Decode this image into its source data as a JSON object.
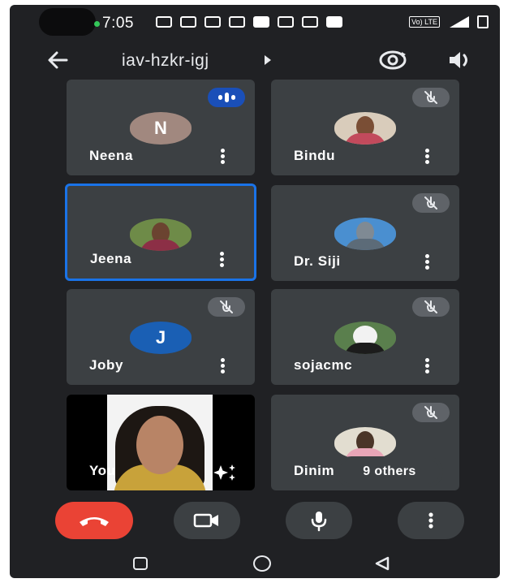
{
  "status_bar": {
    "time": "7:05",
    "network_label": "Vo) LTE"
  },
  "header": {
    "meeting_code": "iav-hzkr-igj"
  },
  "participants": [
    {
      "name": "Neena",
      "avatar_letter": "N",
      "avatar_color": "#a1887f",
      "state": "speaking"
    },
    {
      "name": "Bindu",
      "state": "muted"
    },
    {
      "name": "Jeena",
      "state": "active"
    },
    {
      "name": "Dr. Siji",
      "state": "muted"
    },
    {
      "name": "Joby",
      "avatar_letter": "J",
      "avatar_color": "#1a5fb4",
      "state": "muted"
    },
    {
      "name": "sojacmc",
      "state": "muted"
    },
    {
      "name": "You",
      "state": "self-video"
    },
    {
      "name": "Dinim",
      "others_label": "9 others",
      "state": "muted"
    }
  ],
  "colors": {
    "background": "#202124",
    "tile": "#3c4043",
    "active_border": "#1a73e8",
    "end_call": "#ea4335",
    "speaking_badge": "#1a4fb8"
  },
  "controls": {
    "end_call_icon": "hang-up-icon",
    "camera_icon": "video-camera-icon",
    "mic_icon": "microphone-icon",
    "more_icon": "more-vert-icon"
  }
}
